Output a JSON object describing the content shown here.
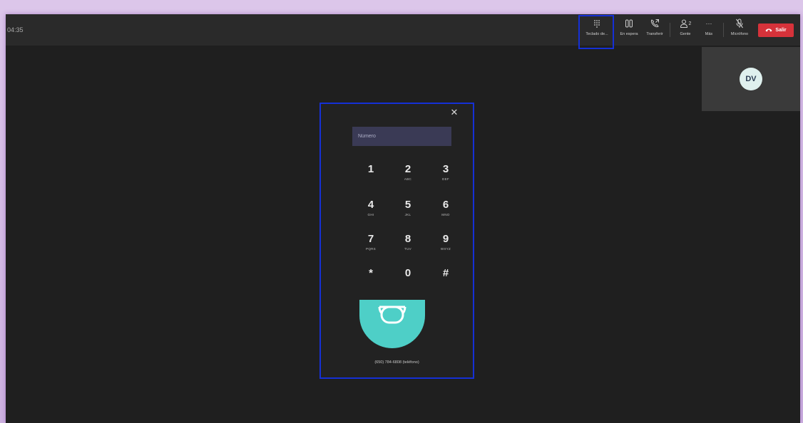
{
  "call": {
    "timer": "04:35"
  },
  "toolbar": {
    "dialpad_label": "Teclado de...",
    "hold_label": "En espera",
    "transfer_label": "Transferir",
    "people_label": "Gente",
    "people_count": "2",
    "more_label": "Más",
    "more_glyph": "···",
    "mic_label": "Micrófono",
    "leave_label": "Salir"
  },
  "participant": {
    "initials": "DV"
  },
  "dialpad": {
    "placeholder": "Número",
    "close_glyph": "✕",
    "keys": [
      {
        "digit": "1",
        "letters": ""
      },
      {
        "digit": "2",
        "letters": "ABC"
      },
      {
        "digit": "3",
        "letters": "DEF"
      },
      {
        "digit": "4",
        "letters": "GHI"
      },
      {
        "digit": "5",
        "letters": "JKL"
      },
      {
        "digit": "6",
        "letters": "MNO"
      },
      {
        "digit": "7",
        "letters": "PQRS"
      },
      {
        "digit": "8",
        "letters": "TUV"
      },
      {
        "digit": "9",
        "letters": "WXYZ"
      },
      {
        "digit": "*",
        "letters": ""
      },
      {
        "digit": "0",
        "letters": ""
      },
      {
        "digit": "#",
        "letters": ""
      }
    ],
    "footer": "(650) 784-6808 (teléfono)"
  },
  "colors": {
    "highlight": "#1530d6",
    "leave": "#d6323a",
    "call_button": "#4ecfc7"
  }
}
